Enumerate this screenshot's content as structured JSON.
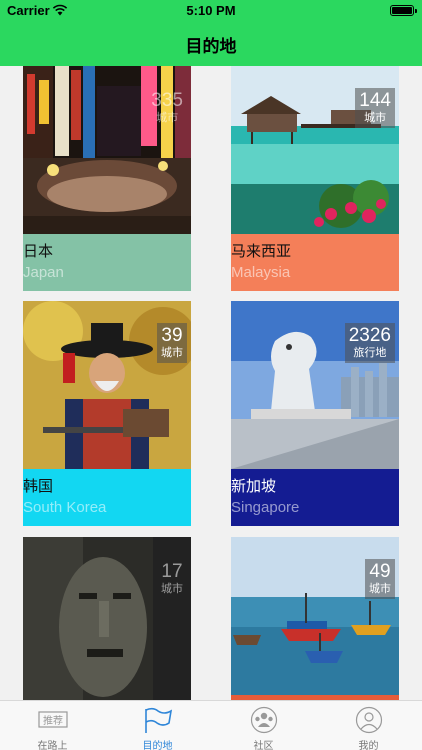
{
  "status_bar": {
    "carrier": "Carrier",
    "time": "5:10 PM",
    "icons": [
      "wifi-icon",
      "battery-icon"
    ]
  },
  "nav": {
    "title": "目的地",
    "bar_color": "#2bd85f"
  },
  "destinations": [
    {
      "name_cn": "日本",
      "name_en": "Japan",
      "count": "335",
      "unit": "城市",
      "color": "#84c2a6"
    },
    {
      "name_cn": "马来西亚",
      "name_en": "Malaysia",
      "count": "144",
      "unit": "城市",
      "color": "#f47f59"
    },
    {
      "name_cn": "韩国",
      "name_en": "South Korea",
      "count": "39",
      "unit": "城市",
      "color": "#12d7f2"
    },
    {
      "name_cn": "新加坡",
      "name_en": "Singapore",
      "count": "2326",
      "unit": "旅行地",
      "color": "#141c92"
    },
    {
      "name_cn": "",
      "name_en": "",
      "count": "17",
      "unit": "城市",
      "color": "#444444"
    },
    {
      "name_cn": "",
      "name_en": "",
      "count": "49",
      "unit": "城市",
      "color": "#f47f59"
    }
  ],
  "tabbar": {
    "active_color": "#2f86d8",
    "items": [
      {
        "label": "在路上",
        "icon": "recommend-icon",
        "badge": "推荐"
      },
      {
        "label": "目的地",
        "icon": "flag-icon"
      },
      {
        "label": "社区",
        "icon": "community-icon"
      },
      {
        "label": "我的",
        "icon": "profile-icon"
      }
    ]
  }
}
